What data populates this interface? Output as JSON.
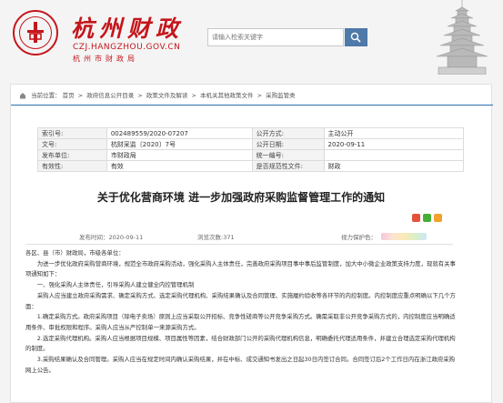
{
  "header": {
    "site_name": "杭州财政",
    "domain": "CZJ.HANGZHOU.GOV.CN",
    "subtitle": "杭州市财政局",
    "search_placeholder": "请输入检索关键字"
  },
  "breadcrumb": {
    "prefix": "当前位置：",
    "items": [
      "首页",
      "政府信息公开目录",
      "政策文件及解读",
      "本机关其他政策文件",
      "采购监管类"
    ]
  },
  "meta": {
    "rows": [
      [
        "索引号:",
        "002489559/2020-07207",
        "公开方式:",
        "主动公开"
      ],
      [
        "文号:",
        "杭财采监〔2020〕7号",
        "公开日期:",
        "2020-09-11"
      ],
      [
        "发布单位:",
        "市财政局",
        "统一编号:",
        ""
      ],
      [
        "有效性:",
        "有效",
        "是否规范性文件:",
        "财政"
      ]
    ]
  },
  "article": {
    "title": "关于优化营商环境 进一步加强政府采购监督管理工作的通知",
    "date_label": "发布时间：2020-09-11",
    "views_label": "浏览次数:371",
    "font_label": "视力保护色：",
    "paragraphs": [
      "各区、县（市）财政局，市级各单位：",
      "为进一步优化政府采购营商环境，规范全市政府采购活动，强化采购人主体责任，完善政府采购项目事中事后监管制度，加大中小微企业政策支持力度，现就有关事项通知如下：",
      "一、强化采购人主体责任，引导采购人建立健全内控管理机制",
      "采购人应当建立政府采购需求、确定采购方式、选定采购代理机构、采购结果确认及合同管理、实施履约验收等各环节的内控制度。内控制度应重点明确以下几个方面：",
      "1.确定采购方式。政府采购项目（除电子卖场）原则上应当采取公开招标、竞争性磋商等公开竞争采购方式。确需采取非公开竞争采购方式的，内控制度应当明确适用条件、审批权限和程序。采购人应当从严控制单一来源采购方式。",
      "2.选定采购代理机构。采购人应当根据项目规模、项目属性等因素，结合财政部门公开的采购代理机构信息，明确委托代理适用条件，并建立合理选定采购代理机构的制度。",
      "3.采购结果确认及合同管理。采购人应当在规定时间内确认采购结果，并在中标、成交通知书发出之日起30日内签订合同。合同签订后2个工作日内在浙江政府采购网上公告。"
    ]
  },
  "colors": {
    "brand_red": "#c4161c",
    "accent_blue": "#2f6fae",
    "search_button": "#4f79a8"
  },
  "icons": [
    "emblem-logo",
    "search-icon",
    "pagoda-illustration",
    "home-icon",
    "share-weibo-icon",
    "share-wechat-icon",
    "share-qzone-icon"
  ]
}
